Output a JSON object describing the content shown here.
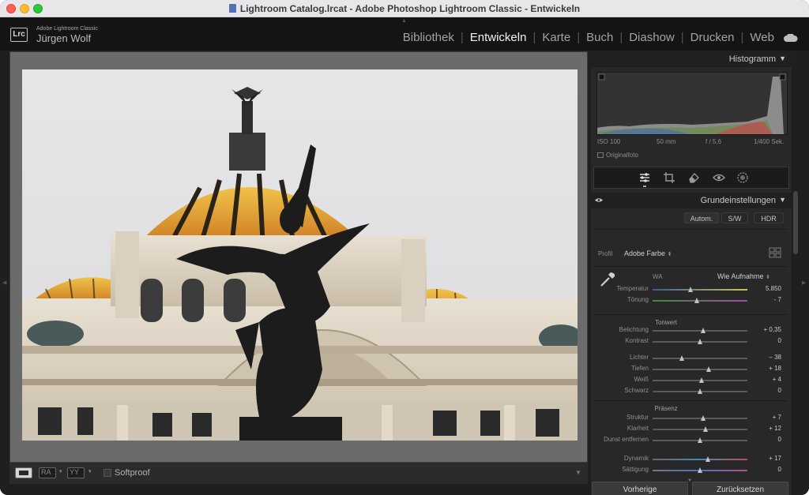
{
  "window": {
    "title": "Lightroom Catalog.lrcat - Adobe Photoshop Lightroom Classic - Entwickeln"
  },
  "identity": {
    "logo": "Lrc",
    "app": "Adobe Lightroom Classic",
    "user": "Jürgen Wolf"
  },
  "modules": [
    {
      "label": "Bibliothek",
      "active": false
    },
    {
      "label": "Entwickeln",
      "active": true
    },
    {
      "label": "Karte",
      "active": false
    },
    {
      "label": "Buch",
      "active": false
    },
    {
      "label": "Diashow",
      "active": false
    },
    {
      "label": "Drucken",
      "active": false
    },
    {
      "label": "Web",
      "active": false
    }
  ],
  "toolbar": {
    "softproof": "Softproof",
    "softproof_checked": false,
    "compare_labels": [
      "RA",
      "YY"
    ]
  },
  "histogram": {
    "title": "Histogramm",
    "iso": "ISO 100",
    "focal": "50 mm",
    "aperture": "f / 5,6",
    "shutter": "1/400 Sek.",
    "original": "Originalfoto"
  },
  "tools": [
    "sliders-icon",
    "crop-icon",
    "eraser-icon",
    "redeye-icon",
    "mask-icon"
  ],
  "basic": {
    "title": "Grundeinstellungen",
    "auto": "Autom.",
    "bw": "S/W",
    "hdr": "HDR",
    "profile_label": "Profil",
    "profile_value": "Adobe Farbe",
    "wb_label": "WA",
    "wb_value": "Wie Aufnahme",
    "tone_header": "Tonwert",
    "presence_header": "Präsenz",
    "sliders": {
      "temperatur": {
        "label": "Temperatur",
        "value": "5.850",
        "pos": 0.4
      },
      "tonung": {
        "label": "Tönung",
        "value": "- 7",
        "pos": 0.47
      },
      "belichtung": {
        "label": "Belichtung",
        "value": "+ 0,35",
        "pos": 0.53
      },
      "kontrast": {
        "label": "Kontrast",
        "value": "0",
        "pos": 0.5
      },
      "lichter": {
        "label": "Lichter",
        "value": "– 38",
        "pos": 0.31
      },
      "tiefen": {
        "label": "Tiefen",
        "value": "+ 18",
        "pos": 0.59
      },
      "weiss": {
        "label": "Weiß",
        "value": "+ 4",
        "pos": 0.52
      },
      "schwarz": {
        "label": "Schwarz",
        "value": "0",
        "pos": 0.5
      },
      "struktur": {
        "label": "Struktur",
        "value": "+ 7",
        "pos": 0.53
      },
      "klarheit": {
        "label": "Klarheit",
        "value": "+ 12",
        "pos": 0.56
      },
      "dunst": {
        "label": "Dunst entfernen",
        "value": "0",
        "pos": 0.5
      },
      "dynamik": {
        "label": "Dynamik",
        "value": "+ 17",
        "pos": 0.58
      },
      "saettigung": {
        "label": "Sättigung",
        "value": "0",
        "pos": 0.5
      }
    }
  },
  "buttons": {
    "previous": "Vorherige",
    "reset": "Zurücksetzen"
  }
}
